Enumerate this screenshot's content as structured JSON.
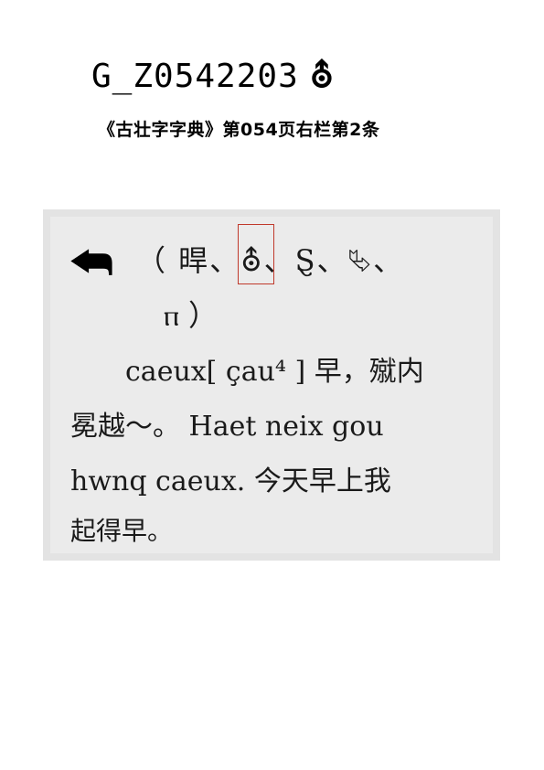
{
  "header": {
    "code": "G_Z0542203",
    "glyph": "⛢",
    "source": "《古壮字字典》第054页右栏第2条"
  },
  "scan": {
    "headword": "⮪",
    "variants_line1": "（ 晘、⛢、Ȿ、⮱、",
    "variants_line2": "ⲡ ）",
    "body_line1": "caeux[ çau⁴ ] 早，殧内",
    "body_line2": "冕越～。 Haet neix gou",
    "body_line3": "hwnq caeux. 今天早上我",
    "body_line4": "起得早。"
  },
  "colors": {
    "highlight": "#c0392b",
    "scan_background": "#e3e3e3"
  }
}
